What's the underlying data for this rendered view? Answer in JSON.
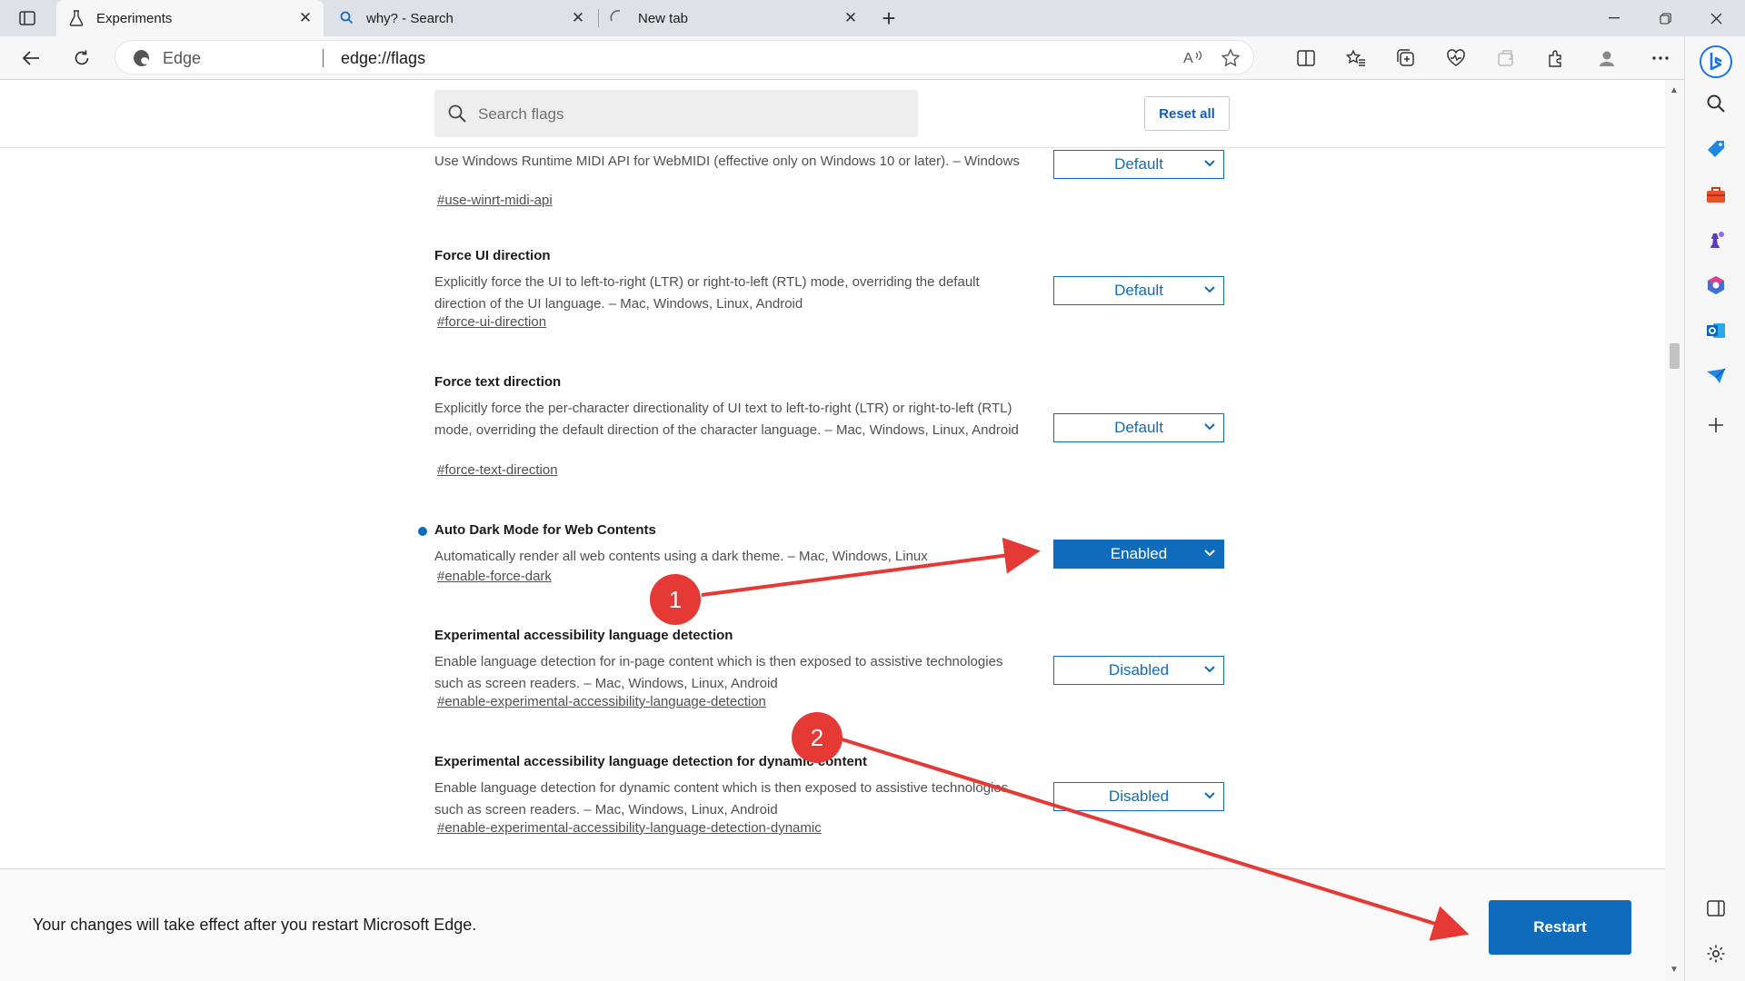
{
  "browser": {
    "tabs": [
      {
        "title": "Experiments",
        "icon": "flask-icon"
      },
      {
        "title": "why? - Search",
        "icon": "search-icon"
      },
      {
        "title": "New tab",
        "icon": "loading-icon"
      }
    ],
    "address": {
      "site_label": "Edge",
      "url": "edge://flags"
    }
  },
  "flags_page": {
    "search_placeholder": "Search flags",
    "reset_all_label": "Reset all",
    "flags": [
      {
        "title": "",
        "description": "Use Windows Runtime MIDI API for WebMIDI (effective only on Windows 10 or later). – Windows",
        "link": "#use-winrt-midi-api",
        "value": "Default"
      },
      {
        "title": "Force UI direction",
        "description": "Explicitly force the UI to left-to-right (LTR) or right-to-left (RTL) mode, overriding the default direction of the UI language. – Mac, Windows, Linux, Android",
        "link": "#force-ui-direction",
        "value": "Default"
      },
      {
        "title": "Force text direction",
        "description": "Explicitly force the per-character directionality of UI text to left-to-right (LTR) or right-to-left (RTL) mode, overriding the default direction of the character language. – Mac, Windows, Linux, Android",
        "link": "#force-text-direction",
        "value": "Default"
      },
      {
        "title": "Auto Dark Mode for Web Contents",
        "description": "Automatically render all web contents using a dark theme. – Mac, Windows, Linux",
        "link": "#enable-force-dark",
        "value": "Enabled",
        "modified": true
      },
      {
        "title": "Experimental accessibility language detection",
        "description": "Enable language detection for in-page content which is then exposed to assistive technologies such as screen readers. – Mac, Windows, Linux, Android",
        "link": "#enable-experimental-accessibility-language-detection",
        "value": "Disabled"
      },
      {
        "title": "Experimental accessibility language detection for dynamic content",
        "description": "Enable language detection for dynamic content which is then exposed to assistive technologies such as screen readers. – Mac, Windows, Linux, Android",
        "link": "#enable-experimental-accessibility-language-detection-dynamic",
        "value": "Disabled"
      }
    ]
  },
  "restart_bar": {
    "message": "Your changes will take effect after you restart Microsoft Edge.",
    "button_label": "Restart"
  },
  "annotations": {
    "callouts": [
      "1",
      "2"
    ],
    "color": "#e53935"
  },
  "colors": {
    "accent": "#0f6cbd",
    "tabstrip": "#dee1e6",
    "toolbar": "#f7f7f7"
  }
}
